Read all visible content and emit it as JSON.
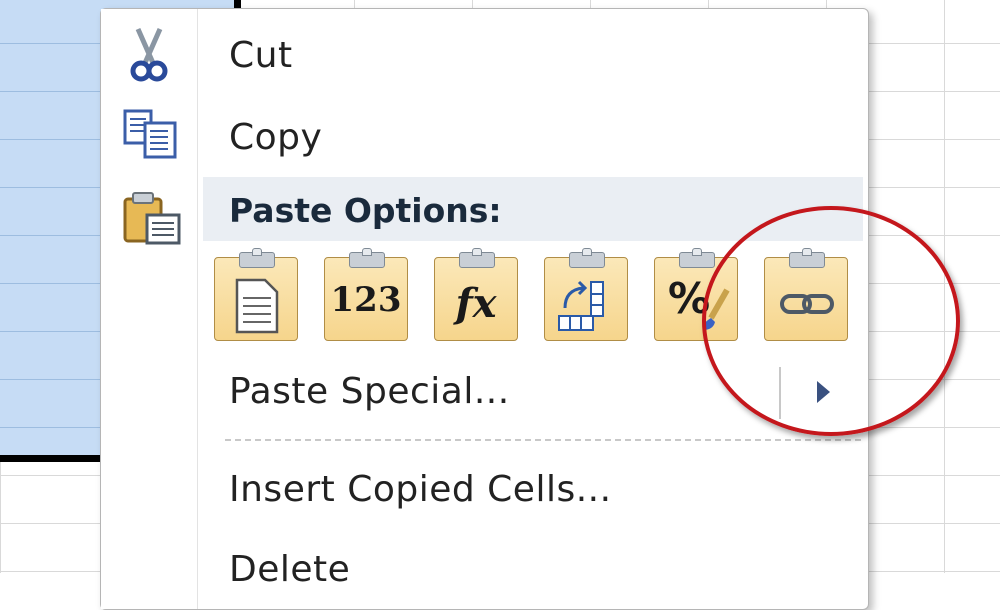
{
  "menu": {
    "cut_label": "Cut",
    "copy_label": "Copy",
    "paste_options_label": "Paste Options:",
    "paste_special_label": "Paste Special...",
    "insert_copied_cells_label": "Insert Copied Cells...",
    "delete_label": "Delete"
  },
  "paste_buttons": [
    {
      "name": "paste",
      "icon": "paste-document-icon",
      "glyph": ""
    },
    {
      "name": "values",
      "icon": "paste-values-icon",
      "glyph": "123"
    },
    {
      "name": "formulas",
      "icon": "paste-formulas-icon",
      "glyph": "fx"
    },
    {
      "name": "transpose",
      "icon": "paste-transpose-icon",
      "glyph": ""
    },
    {
      "name": "formatting",
      "icon": "paste-formatting-icon",
      "glyph": "%"
    },
    {
      "name": "link",
      "icon": "paste-link-icon",
      "glyph": ""
    }
  ],
  "colors": {
    "selection": "#c6dcf5",
    "paste_header_bg": "#eaeef3",
    "annotation_circle": "#c4171c",
    "button_fill": "#f6d58c"
  }
}
